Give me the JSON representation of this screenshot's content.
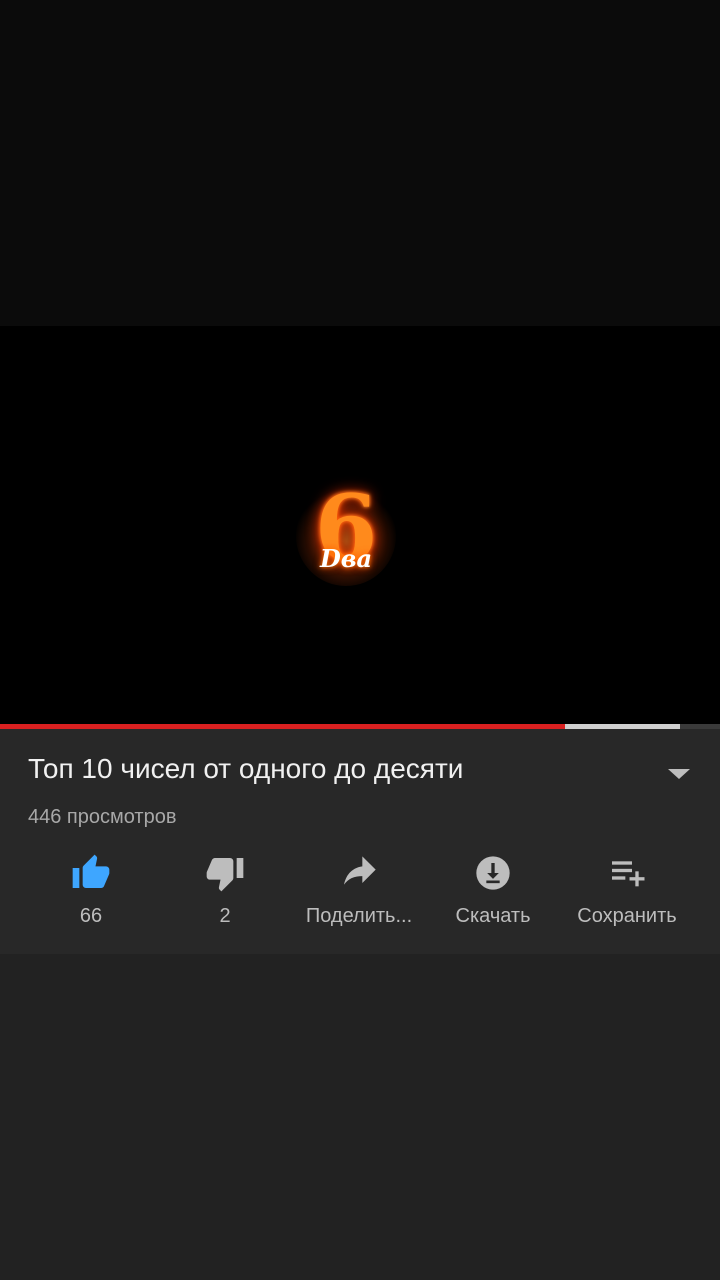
{
  "player": {
    "thumbnail_number": "6",
    "thumbnail_word": "Dва",
    "progress_played": 0.785,
    "progress_buffered_end": 0.945
  },
  "video": {
    "title": "Топ 10 чисел от одного до десяти",
    "views": "446 просмотров"
  },
  "actions": {
    "like_count": "66",
    "dislike_count": "2",
    "share_label": "Поделить...",
    "download_label": "Скачать",
    "save_label": "Сохранить"
  },
  "colors": {
    "accent_blue": "#3ea6ff",
    "progress_red": "#d92020",
    "icon_gray": "#bdbdbd"
  },
  "icons": [
    "thumb-up-icon",
    "thumb-down-icon",
    "share-icon",
    "download-icon",
    "save-playlist-icon",
    "chevron-down-icon"
  ]
}
